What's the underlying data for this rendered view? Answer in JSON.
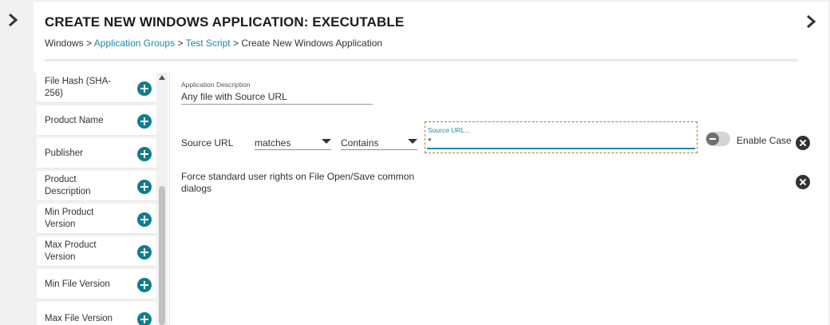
{
  "rail": {
    "chevron_icon": "chevron-right-icon"
  },
  "header": {
    "title": "CREATE NEW WINDOWS APPLICATION: EXECUTABLE",
    "chevron_icon": "chevron-right-icon"
  },
  "breadcrumb": {
    "items": [
      {
        "label": "Windows",
        "link": false
      },
      {
        "label": "Application Groups",
        "link": true
      },
      {
        "label": "Test Script",
        "link": true
      },
      {
        "label": "Create New Windows Application",
        "link": false
      }
    ],
    "separator": ">"
  },
  "attributes": {
    "items": [
      {
        "label": "File Hash (SHA-256)"
      },
      {
        "label": "Product Name"
      },
      {
        "label": "Publisher"
      },
      {
        "label": "Product Description"
      },
      {
        "label": "Min Product Version"
      },
      {
        "label": "Max Product Version"
      },
      {
        "label": "Min File Version"
      },
      {
        "label": "Max File Version"
      }
    ],
    "add_icon": "plus-circle-icon"
  },
  "form": {
    "description_caption": "Application Description",
    "description_value": "Any file with Source URL",
    "source_url": {
      "label": "Source URL",
      "operator": "matches",
      "match_type": "Contains",
      "input_caption": "Source URL...",
      "input_value": "*",
      "enable_case_label": "Enable Case",
      "enable_case_on": false
    },
    "force_rights_text": "Force standard user rights on File Open/Save common dialogs"
  },
  "colors": {
    "accent": "#0f7d8e",
    "link": "#1b8aa8",
    "focus_border": "#c0752a"
  }
}
